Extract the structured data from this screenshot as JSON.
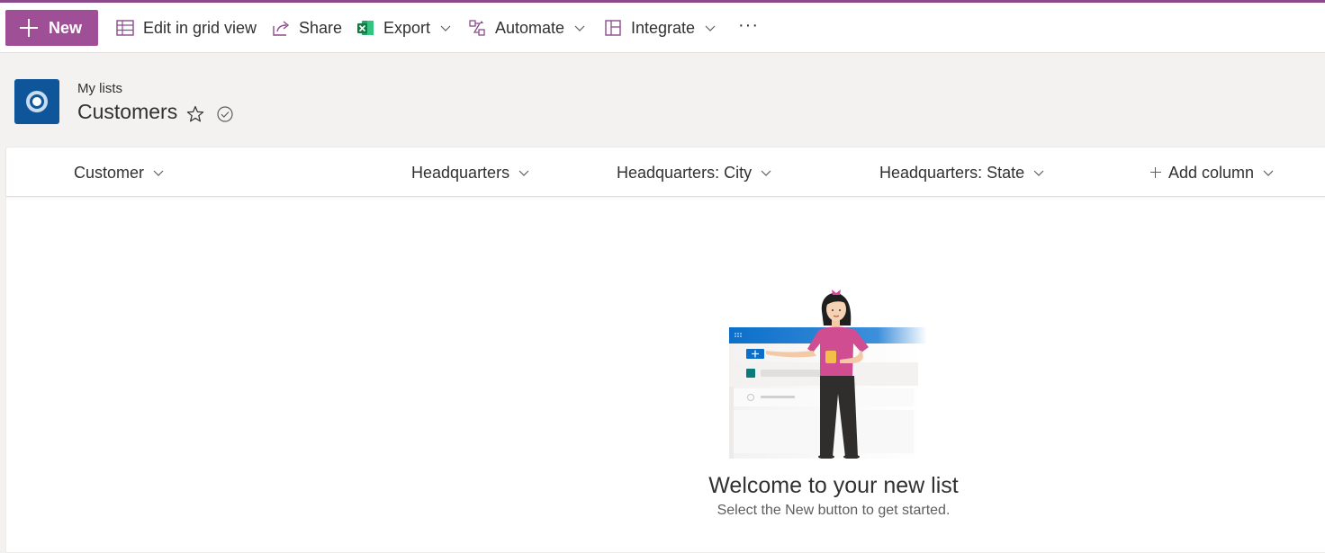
{
  "colors": {
    "brand": "#9e4f95",
    "accent_line": "#8c4a8c",
    "site_icon": "#0f5599"
  },
  "toolbar": {
    "new_label": "New",
    "edit_grid_label": "Edit in grid view",
    "share_label": "Share",
    "export_label": "Export",
    "automate_label": "Automate",
    "integrate_label": "Integrate",
    "more_label": "···"
  },
  "header": {
    "breadcrumb": "My lists",
    "title": "Customers"
  },
  "columns": [
    {
      "label": "Customer"
    },
    {
      "label": "Headquarters"
    },
    {
      "label": "Headquarters: City"
    },
    {
      "label": "Headquarters: State"
    },
    {
      "label": "Add column"
    }
  ],
  "empty_state": {
    "title": "Welcome to your new list",
    "subtitle": "Select the New button to get started."
  },
  "icons": [
    "plus-icon",
    "grid-icon",
    "share-icon",
    "excel-icon",
    "automate-icon",
    "integrate-icon",
    "more-icon",
    "favorite-star-icon",
    "check-circle-icon",
    "chevron-down-icon"
  ]
}
